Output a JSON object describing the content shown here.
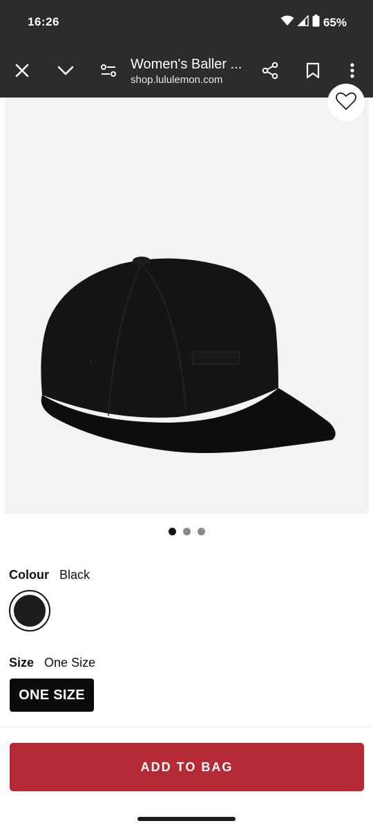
{
  "status_bar": {
    "time": "16:26",
    "battery": "65%",
    "icons": [
      "wifi-icon",
      "signal-icon",
      "battery-icon"
    ]
  },
  "toolbar": {
    "title": "Women's Baller ...",
    "url": "shop.lululemon.com",
    "icons": [
      "close-icon",
      "chevron-down-icon",
      "tune-icon",
      "share-icon",
      "bookmark-icon",
      "more-vert-icon"
    ]
  },
  "product": {
    "image_icon": "baseball-cap-image",
    "wishlist_icon": "heart-icon",
    "carousel": {
      "count": 3,
      "active": 0
    },
    "colour_label": "Colour",
    "colour_value": "Black",
    "swatch_color": "#1d1d1d",
    "size_label": "Size",
    "size_value": "One Size",
    "size_option": "ONE SIZE"
  },
  "cta": {
    "add_to_bag": "ADD TO BAG",
    "color": "#b52a35"
  }
}
